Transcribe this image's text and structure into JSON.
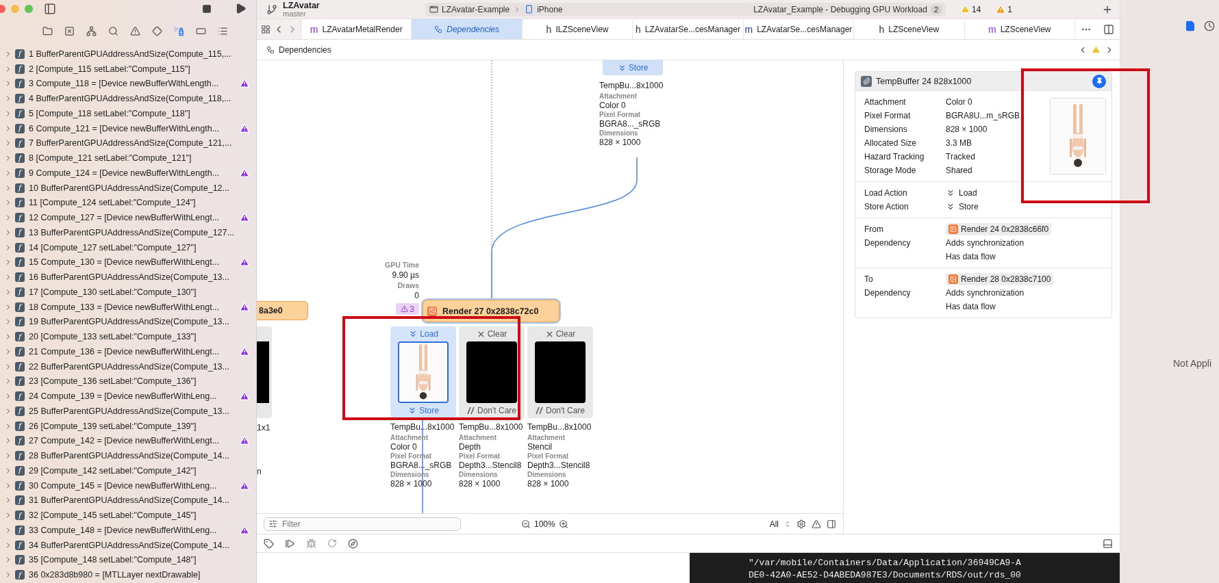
{
  "window": {
    "project": "LZAvatar",
    "branch": "master",
    "scheme": "LZAvatar-Example",
    "device": "iPhone",
    "status": "LZAvatar_Example - Debugging GPU Workload",
    "status_badge": "2",
    "warnings": "14",
    "issues": "1"
  },
  "navigator_tabs": [
    {
      "kind": "folder",
      "selected": false
    },
    {
      "kind": "source-control",
      "selected": false
    },
    {
      "kind": "symbols",
      "selected": false
    },
    {
      "kind": "search",
      "selected": false
    },
    {
      "kind": "issues",
      "selected": false
    },
    {
      "kind": "tests",
      "selected": false
    },
    {
      "kind": "debug",
      "selected": true
    },
    {
      "kind": "breakpoints",
      "selected": false
    },
    {
      "kind": "reports",
      "selected": false
    }
  ],
  "navigator_rows": [
    {
      "icon": "f",
      "text": "1 BufferParentGPUAddressAndSize(Compute_115,...",
      "warning": false
    },
    {
      "icon": "f",
      "text": "2 [Compute_115 setLabel:\"Compute_115\"]",
      "warning": false
    },
    {
      "icon": "f",
      "text": "3 Compute_118 = [Device newBufferWithLength...",
      "warning": true
    },
    {
      "icon": "f",
      "text": "4 BufferParentGPUAddressAndSize(Compute_118,...",
      "warning": false
    },
    {
      "icon": "f",
      "text": "5 [Compute_118 setLabel:\"Compute_118\"]",
      "warning": false
    },
    {
      "icon": "f",
      "text": "6 Compute_121 = [Device newBufferWithLength...",
      "warning": true
    },
    {
      "icon": "f",
      "text": "7 BufferParentGPUAddressAndSize(Compute_121,...",
      "warning": false
    },
    {
      "icon": "f",
      "text": "8 [Compute_121 setLabel:\"Compute_121\"]",
      "warning": false
    },
    {
      "icon": "f",
      "text": "9 Compute_124 = [Device newBufferWithLength...",
      "warning": true
    },
    {
      "icon": "f",
      "text": "10 BufferParentGPUAddressAndSize(Compute_12...",
      "warning": false
    },
    {
      "icon": "f",
      "text": "11 [Compute_124 setLabel:\"Compute_124\"]",
      "warning": false
    },
    {
      "icon": "f",
      "text": "12 Compute_127 = [Device newBufferWithLengt...",
      "warning": true
    },
    {
      "icon": "f",
      "text": "13 BufferParentGPUAddressAndSize(Compute_127...",
      "warning": false
    },
    {
      "icon": "f",
      "text": "14 [Compute_127 setLabel:\"Compute_127\"]",
      "warning": false
    },
    {
      "icon": "f",
      "text": "15 Compute_130 = [Device newBufferWithLengt...",
      "warning": true
    },
    {
      "icon": "f",
      "text": "16 BufferParentGPUAddressAndSize(Compute_13...",
      "warning": false
    },
    {
      "icon": "f",
      "text": "17 [Compute_130 setLabel:\"Compute_130\"]",
      "warning": false
    },
    {
      "icon": "f",
      "text": "18 Compute_133 = [Device newBufferWithLengt...",
      "warning": true
    },
    {
      "icon": "f",
      "text": "19 BufferParentGPUAddressAndSize(Compute_13...",
      "warning": false
    },
    {
      "icon": "f",
      "text": "20 [Compute_133 setLabel:\"Compute_133\"]",
      "warning": false
    },
    {
      "icon": "f",
      "text": "21 Compute_136 = [Device newBufferWithLengt...",
      "warning": true
    },
    {
      "icon": "f",
      "text": "22 BufferParentGPUAddressAndSize(Compute_13...",
      "warning": false
    },
    {
      "icon": "f",
      "text": "23 [Compute_136 setLabel:\"Compute_136\"]",
      "warning": false
    },
    {
      "icon": "f",
      "text": "24 Compute_139 = [Device newBufferWithLeng...",
      "warning": true
    },
    {
      "icon": "f",
      "text": "25 BufferParentGPUAddressAndSize(Compute_13...",
      "warning": false
    },
    {
      "icon": "f",
      "text": "26 [Compute_139 setLabel:\"Compute_139\"]",
      "warning": false
    },
    {
      "icon": "f",
      "text": "27 Compute_142 = [Device newBufferWithLengt...",
      "warning": true
    },
    {
      "icon": "f",
      "text": "28 BufferParentGPUAddressAndSize(Compute_14...",
      "warning": false
    },
    {
      "icon": "f",
      "text": "29 [Compute_142 setLabel:\"Compute_142\"]",
      "warning": false
    },
    {
      "icon": "f",
      "text": "30 Compute_145 = [Device newBufferWithLeng...",
      "warning": true
    },
    {
      "icon": "f",
      "text": "31 BufferParentGPUAddressAndSize(Compute_14...",
      "warning": false
    },
    {
      "icon": "f",
      "text": "32 [Compute_145 setLabel:\"Compute_145\"]",
      "warning": false
    },
    {
      "icon": "f",
      "text": "33 Compute_148 = [Device newBufferWithLeng...",
      "warning": true
    },
    {
      "icon": "f",
      "text": "34 BufferParentGPUAddressAndSize(Compute_14...",
      "warning": false
    },
    {
      "icon": "f",
      "text": "35 [Compute_148 setLabel:\"Compute_148\"]",
      "warning": false
    },
    {
      "icon": "f",
      "text": "36 0x283d8b980 = [MTLLayer nextDrawable]",
      "warning": false
    }
  ],
  "tabs": [
    {
      "kind": "implementation",
      "icon": "m",
      "label": "LZAvatarMetalRender",
      "selected": false
    },
    {
      "kind": "dependencies",
      "label": "Dependencies",
      "selected": true
    },
    {
      "kind": "header",
      "icon": "h",
      "label": "ILZSceneView",
      "selected": false
    },
    {
      "kind": "header",
      "icon": "h",
      "label": "LZAvatarSe...cesManager",
      "selected": false
    },
    {
      "kind": "objc",
      "icon": "m",
      "label": "LZAvatarSe...cesManager",
      "selected": false
    },
    {
      "kind": "header",
      "icon": "h",
      "label": "LZSceneView",
      "selected": false
    },
    {
      "kind": "implementation",
      "icon": "m",
      "label": "LZSceneView",
      "selected": false
    }
  ],
  "jump_bar": {
    "path": "Dependencies"
  },
  "graph": {
    "top_node": {
      "store": "Store",
      "name": "TempBu...8x1000",
      "fields": [
        {
          "label": "Attachment",
          "value": "Color 0"
        },
        {
          "label": "Pixel Format",
          "value": "BGRA8..._sRGB"
        },
        {
          "label": "Dimensions",
          "value": "828 × 1000"
        }
      ]
    },
    "left_node": {
      "title": "8a3e0",
      "texts": [
        "1x1",
        "n"
      ]
    },
    "stats": [
      {
        "label": "GPU Time",
        "value": "9.90 µs"
      },
      {
        "label": "Draws",
        "value": "0"
      }
    ],
    "warning_count": "3",
    "render_node": {
      "title": "Render 27 0x2838c72c0",
      "selected": true
    },
    "attachments": [
      {
        "load": {
          "kind": "load",
          "label": "Load"
        },
        "store": {
          "kind": "store",
          "label": "Store"
        },
        "selected": true,
        "name": "TempBu...8x1000",
        "fields": [
          {
            "label": "Attachment",
            "value": "Color 0"
          },
          {
            "label": "Pixel Format",
            "value": "BGRA8..._sRGB"
          },
          {
            "label": "Dimensions",
            "value": "828 × 1000"
          }
        ]
      },
      {
        "load": {
          "kind": "clear",
          "label": "Clear"
        },
        "store": {
          "kind": "dontcare",
          "label": "Don't Care"
        },
        "thumbnail": {
          "kind": "black"
        },
        "selected": false,
        "name": "TempBu...8x1000",
        "fields": [
          {
            "label": "Attachment",
            "value": "Depth"
          },
          {
            "label": "Pixel Format",
            "value": "Depth3...Stencil8"
          },
          {
            "label": "Dimensions",
            "value": "828 × 1000"
          }
        ]
      },
      {
        "load": {
          "kind": "clear",
          "label": "Clear"
        },
        "store": {
          "kind": "dontcare",
          "label": "Don't Care"
        },
        "thumbnail": {
          "kind": "black"
        },
        "selected": false,
        "name": "TempBu...8x1000",
        "fields": [
          {
            "label": "Attachment",
            "value": "Stencil"
          },
          {
            "label": "Pixel Format",
            "value": "Depth3...Stencil8"
          },
          {
            "label": "Dimensions",
            "value": "828 × 1000"
          }
        ]
      }
    ]
  },
  "inspector": {
    "title": "TempBuffer 24 828x1000",
    "pinned": true,
    "properties": [
      {
        "label": "Attachment",
        "value": "Color 0"
      },
      {
        "label": "Pixel Format",
        "value": "BGRA8U...m_sRGB"
      },
      {
        "label": "Dimensions",
        "value": "828 × 1000"
      },
      {
        "label": "Allocated Size",
        "value": "3.3 MB"
      },
      {
        "label": "Hazard Tracking",
        "value": "Tracked"
      },
      {
        "label": "Storage Mode",
        "value": "Shared"
      }
    ],
    "actions": [
      {
        "label": "Load Action",
        "value": "Load"
      },
      {
        "label": "Store Action",
        "value": "Store"
      }
    ],
    "links": [
      {
        "label": "From",
        "target": "Render 24 0x2838c66f0",
        "dependency_label": "Dependency",
        "notes": [
          "Adds synchronization",
          "Has data flow"
        ]
      },
      {
        "label": "To",
        "target": "Render 28 0x2838c7100",
        "dependency_label": "Dependency",
        "notes": [
          "Adds synchronization",
          "Has data flow"
        ]
      }
    ]
  },
  "filter": {
    "placeholder": "Filter",
    "zoom": "100%",
    "scope": "All"
  },
  "console": {
    "lines": [
      "\"/var/mobile/Containers/Data/Application/36949CA9-A",
      "DE0-42A0-AE52-D4ABEDA987E3/Documents/RDS/out/rds_00"
    ]
  },
  "right_pane": {
    "message": "Not Appli"
  }
}
